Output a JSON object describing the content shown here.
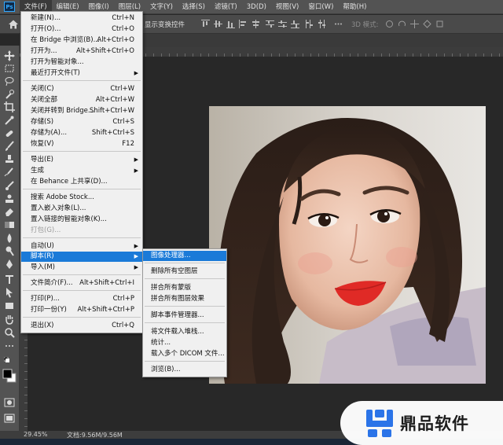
{
  "app": {
    "logo": "Ps"
  },
  "menubar": {
    "items": [
      "文件(F)",
      "编辑(E)",
      "图像(I)",
      "图层(L)",
      "文字(Y)",
      "选择(S)",
      "滤镜(T)",
      "3D(D)",
      "视图(V)",
      "窗口(W)",
      "帮助(H)"
    ],
    "active_index": 0
  },
  "options_bar": {
    "transform_controls_label": "显示变换控件",
    "mode_3d_label": "3D 模式:"
  },
  "file_menu": {
    "items": [
      {
        "label": "新建(N)...",
        "shortcut": "Ctrl+N"
      },
      {
        "label": "打开(O)...",
        "shortcut": "Ctrl+O"
      },
      {
        "label": "在 Bridge 中浏览(B)...",
        "shortcut": "Alt+Ctrl+O"
      },
      {
        "label": "打开为...",
        "shortcut": "Alt+Shift+Ctrl+O"
      },
      {
        "label": "打开为智能对象...",
        "shortcut": ""
      },
      {
        "label": "最近打开文件(T)",
        "shortcut": "",
        "submenu": true
      },
      {
        "label": "关闭(C)",
        "shortcut": "Ctrl+W"
      },
      {
        "label": "关闭全部",
        "shortcut": "Alt+Ctrl+W"
      },
      {
        "label": "关闭并转到 Bridge...",
        "shortcut": "Shift+Ctrl+W"
      },
      {
        "label": "存储(S)",
        "shortcut": "Ctrl+S"
      },
      {
        "label": "存储为(A)...",
        "shortcut": "Shift+Ctrl+S"
      },
      {
        "label": "恢复(V)",
        "shortcut": "F12"
      },
      {
        "label": "导出(E)",
        "shortcut": "",
        "submenu": true
      },
      {
        "label": "生成",
        "shortcut": "",
        "submenu": true
      },
      {
        "label": "在 Behance 上共享(D)...",
        "shortcut": ""
      },
      {
        "label": "搜索 Adobe Stock...",
        "shortcut": ""
      },
      {
        "label": "置入嵌入对象(L)...",
        "shortcut": ""
      },
      {
        "label": "置入链接的智能对象(K)...",
        "shortcut": ""
      },
      {
        "label": "打包(G)...",
        "shortcut": "",
        "disabled": true
      },
      {
        "label": "自动(U)",
        "shortcut": "",
        "submenu": true
      },
      {
        "label": "脚本(R)",
        "shortcut": "",
        "submenu": true,
        "highlighted": true
      },
      {
        "label": "导入(M)",
        "shortcut": "",
        "submenu": true
      },
      {
        "label": "文件简介(F)...",
        "shortcut": "Alt+Shift+Ctrl+I"
      },
      {
        "label": "打印(P)...",
        "shortcut": "Ctrl+P"
      },
      {
        "label": "打印一份(Y)",
        "shortcut": "Alt+Shift+Ctrl+P"
      },
      {
        "label": "退出(X)",
        "shortcut": "Ctrl+Q"
      }
    ]
  },
  "script_submenu": {
    "items": [
      {
        "label": "图像处理器...",
        "highlighted": true
      },
      {
        "label": "删除所有空图层"
      },
      {
        "label": "拼合所有蒙版"
      },
      {
        "label": "拼合所有图层效果"
      },
      {
        "label": "脚本事件管理器..."
      },
      {
        "label": "将文件载入堆栈..."
      },
      {
        "label": "统计..."
      },
      {
        "label": "载入多个 DICOM 文件..."
      },
      {
        "label": "浏览(B)..."
      }
    ]
  },
  "status_bar": {
    "zoom": "29.45%",
    "doc_info": "文档:9.56M/9.56M"
  },
  "watermark": {
    "text": "鼎品软件"
  },
  "colors": {
    "highlight": "#1a7ad8",
    "menu_bg": "#f0f0f0",
    "workspace": "#282828",
    "panel": "#535353"
  }
}
